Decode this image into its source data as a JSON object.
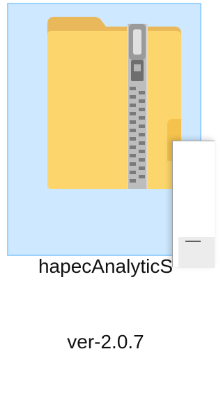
{
  "file": {
    "name_line1": "hapecAnalyticS",
    "name_line2": "ver-2.0.7",
    "icon": "zip-folder-icon",
    "selected": true
  },
  "colors": {
    "selection_fill": "#cde8ff",
    "selection_border": "#99d1ff",
    "folder_back": "#e9b85a",
    "folder_front": "#fcd56c",
    "zipper": "#8a8a8a"
  },
  "overlay": {
    "icon": "minimize-icon"
  }
}
